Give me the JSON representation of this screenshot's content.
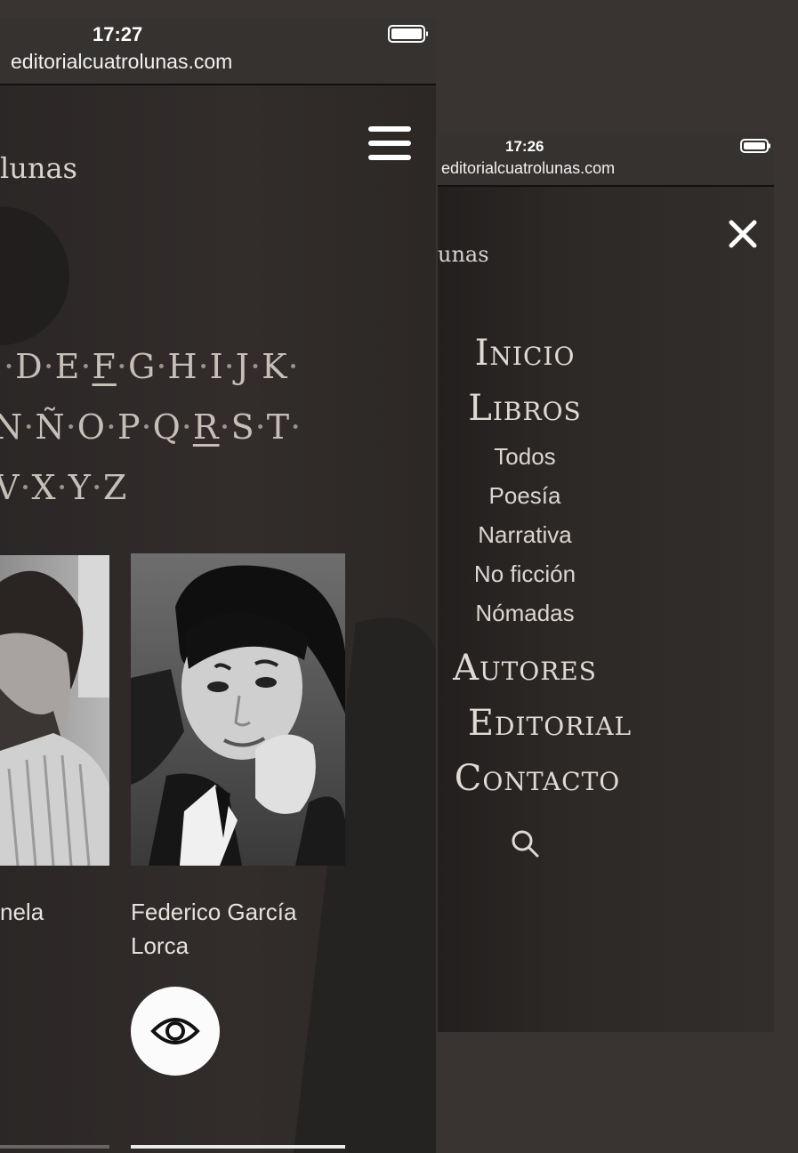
{
  "left_phone": {
    "time": "17:27",
    "url": "editorialcuatrolunas.com",
    "logo_fragment": "lunas",
    "alphabet_rows": [
      [
        {
          "t": "·",
          "sep": true
        },
        {
          "t": "D"
        },
        {
          "t": "·",
          "sep": true
        },
        {
          "t": "E"
        },
        {
          "t": "·",
          "sep": true
        },
        {
          "t": "F",
          "underline": true
        },
        {
          "t": "·",
          "sep": true
        },
        {
          "t": "G"
        },
        {
          "t": "·",
          "sep": true
        },
        {
          "t": "H"
        },
        {
          "t": "·",
          "sep": true
        },
        {
          "t": "I"
        },
        {
          "t": "·",
          "sep": true
        },
        {
          "t": "J"
        },
        {
          "t": "·",
          "sep": true
        },
        {
          "t": "K"
        },
        {
          "t": "·",
          "sep": true
        }
      ],
      [
        {
          "t": "N"
        },
        {
          "t": "·",
          "sep": true
        },
        {
          "t": "Ñ"
        },
        {
          "t": "·",
          "sep": true
        },
        {
          "t": "O"
        },
        {
          "t": "·",
          "sep": true
        },
        {
          "t": "P"
        },
        {
          "t": "·",
          "sep": true
        },
        {
          "t": "Q"
        },
        {
          "t": "·",
          "sep": true
        },
        {
          "t": "R",
          "underline": true
        },
        {
          "t": "·",
          "sep": true
        },
        {
          "t": "S"
        },
        {
          "t": "·",
          "sep": true
        },
        {
          "t": "T"
        },
        {
          "t": "·",
          "sep": true
        }
      ],
      [
        {
          "t": "V"
        },
        {
          "t": "·",
          "sep": true
        },
        {
          "t": "X"
        },
        {
          "t": "·",
          "sep": true
        },
        {
          "t": "Y"
        },
        {
          "t": "·",
          "sep": true
        },
        {
          "t": "Z"
        }
      ]
    ],
    "authors": [
      {
        "name": "nela"
      },
      {
        "name": "Federico García Lorca"
      }
    ]
  },
  "right_phone": {
    "time": "17:26",
    "url": "editorialcuatrolunas.com",
    "logo_fragment": "unas",
    "menu": {
      "inicio": "Inicio",
      "libros": "Libros",
      "sub": [
        "Todos",
        "Poesía",
        "Narrativa",
        "No ficción",
        "Nómadas"
      ],
      "autores": "Autores",
      "editorial": "Editorial",
      "contacto": "Contacto"
    }
  },
  "icons": [
    "hamburger-menu-icon",
    "close-icon",
    "eye-icon",
    "search-icon",
    "battery-icon"
  ],
  "colors": {
    "background": "#393432",
    "panel": "#2d2927",
    "text": "#e0dad4",
    "white": "#ffffff"
  }
}
